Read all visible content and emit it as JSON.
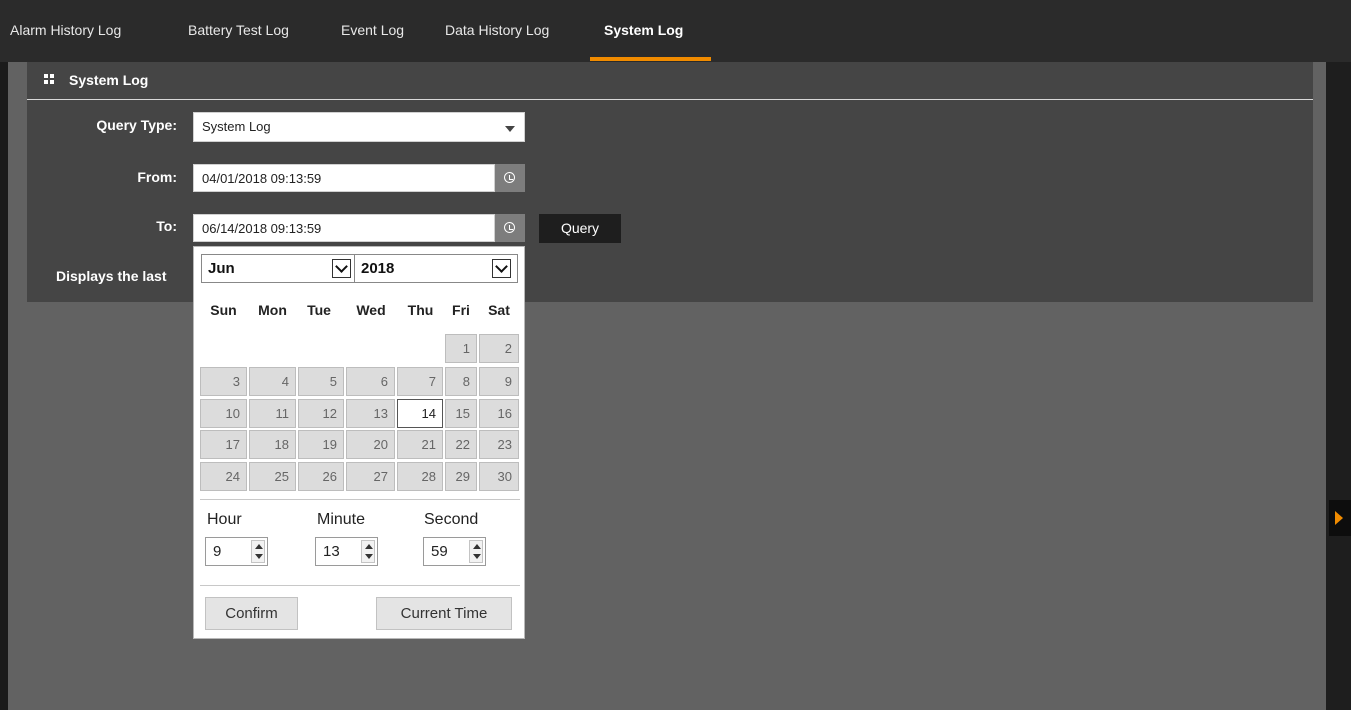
{
  "tabs": [
    "Alarm History Log",
    "Battery Test Log",
    "Event Log",
    "Data History Log",
    "System Log"
  ],
  "active_tab": "System Log",
  "panel": {
    "title": "System Log"
  },
  "form": {
    "query_type_label": "Query Type:",
    "query_type_value": "System Log",
    "from_label": "From:",
    "from_value": "04/01/2018 09:13:59",
    "to_label": "To:",
    "to_value": "06/14/2018 09:13:59",
    "query_button": "Query",
    "displays_text": "Displays the last"
  },
  "calendar": {
    "month": "Jun",
    "year": "2018",
    "weekdays": [
      "Sun",
      "Mon",
      "Tue",
      "Wed",
      "Thu",
      "Fri",
      "Sat"
    ],
    "weeks": [
      [
        "",
        "",
        "",
        "",
        "",
        "1",
        "2"
      ],
      [
        "3",
        "4",
        "5",
        "6",
        "7",
        "8",
        "9"
      ],
      [
        "10",
        "11",
        "12",
        "13",
        "14",
        "15",
        "16"
      ],
      [
        "17",
        "18",
        "19",
        "20",
        "21",
        "22",
        "23"
      ],
      [
        "24",
        "25",
        "26",
        "27",
        "28",
        "29",
        "30"
      ]
    ],
    "selected_day": "14",
    "hour_label": "Hour",
    "minute_label": "Minute",
    "second_label": "Second",
    "hour": "9",
    "minute": "13",
    "second": "59",
    "confirm": "Confirm",
    "current_time": "Current Time"
  },
  "colors": {
    "accent": "#f08b00",
    "tabbar": "#2b2b2b",
    "panel": "#454545",
    "content": "#626262"
  }
}
